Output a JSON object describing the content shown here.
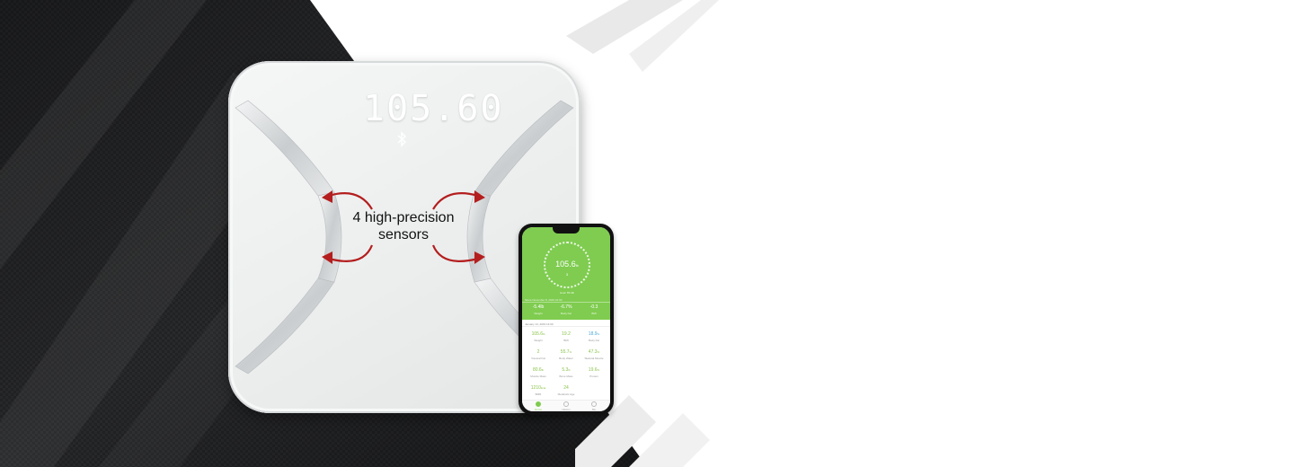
{
  "scale": {
    "display_reading": "105.60",
    "sensor_caption": "4 high-precision sensors"
  },
  "phone": {
    "ring_value": "105.6",
    "ring_unit": "lb",
    "ring_sub": "3",
    "hero_caption": "Goal: 85.0lb",
    "hero_date": "Since November 8, 2019 10:30",
    "hero_stats": [
      {
        "value": "-5.4",
        "unit": "lb",
        "label": "Weight"
      },
      {
        "value": "-6.7",
        "unit": "%",
        "label": "Body Fat"
      },
      {
        "value": "-0.3",
        "unit": "",
        "label": "BMI"
      }
    ],
    "list_date": "January 14, 2019 13:00",
    "metrics": [
      {
        "value": "105.6",
        "unit": "lb",
        "label": "Weight",
        "color": "#8ac44b"
      },
      {
        "value": "19.2",
        "unit": "",
        "label": "BMI",
        "color": "#8ac44b"
      },
      {
        "value": "18.9",
        "unit": "%",
        "label": "Body Fat",
        "color": "#4aa8d8"
      },
      {
        "value": "2",
        "unit": "",
        "label": "Visceral Fat",
        "color": "#8ac44b"
      },
      {
        "value": "55.7",
        "unit": "%",
        "label": "Body Water",
        "color": "#8ac44b"
      },
      {
        "value": "47.3",
        "unit": "%",
        "label": "Skeletal Muscle",
        "color": "#8ac44b"
      },
      {
        "value": "80.6",
        "unit": "lb",
        "label": "Muscle Mass",
        "color": "#8ac44b"
      },
      {
        "value": "5.3",
        "unit": "lb",
        "label": "Bone Mass",
        "color": "#8ac44b"
      },
      {
        "value": "19.6",
        "unit": "%",
        "label": "Protein",
        "color": "#8ac44b"
      },
      {
        "value": "1210",
        "unit": "kcal",
        "label": "BMR",
        "color": "#8ac44b"
      },
      {
        "value": "24",
        "unit": "",
        "label": "Metabolic Age",
        "color": "#8ac44b"
      }
    ],
    "tabs": [
      "Home",
      "History",
      "Me"
    ]
  },
  "colors": {
    "accent_green": "#7fcc50",
    "sensor_arrow_red": "#b41e1e",
    "background_dark": "#2a2b2d"
  }
}
